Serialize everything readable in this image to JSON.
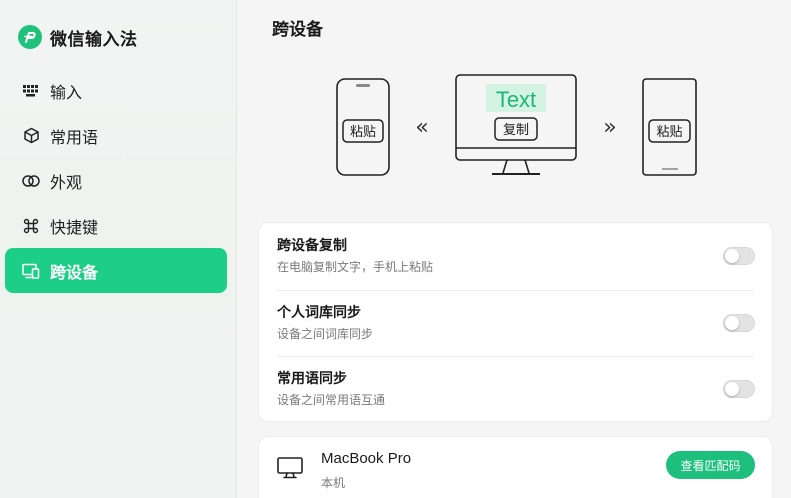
{
  "app": {
    "name": "微信输入法"
  },
  "sidebar": {
    "items": [
      {
        "label": "输入",
        "icon": "keyboard-icon"
      },
      {
        "label": "常用语",
        "icon": "cube-icon"
      },
      {
        "label": "外观",
        "icon": "overlap-circles-icon"
      },
      {
        "label": "快捷键",
        "icon": "command-key-icon"
      },
      {
        "label": "跨设备",
        "icon": "devices-icon",
        "active": true
      }
    ]
  },
  "page": {
    "title": "跨设备"
  },
  "illustration": {
    "left_phone_label": "粘贴",
    "right_phone_label": "粘贴",
    "monitor_text": "Text",
    "monitor_button_label": "复制",
    "left_arrow": "«",
    "right_arrow": "»"
  },
  "settings": [
    {
      "title": "跨设备复制",
      "description": "在电脑复制文字，手机上粘贴",
      "enabled": false
    },
    {
      "title": "个人词库同步",
      "description": "设备之间词库同步",
      "enabled": false
    },
    {
      "title": "常用语同步",
      "description": "设备之间常用语互通",
      "enabled": false
    }
  ],
  "device": {
    "name": "MacBook Pro",
    "subtitle": "本机",
    "button_label": "查看匹配码",
    "icon": "monitor-icon"
  },
  "colors": {
    "accent": "#1dcf86",
    "button": "#1dbf7d",
    "text_highlight_bg": "#d4f3e3",
    "text_highlight_fg": "#1db874"
  }
}
